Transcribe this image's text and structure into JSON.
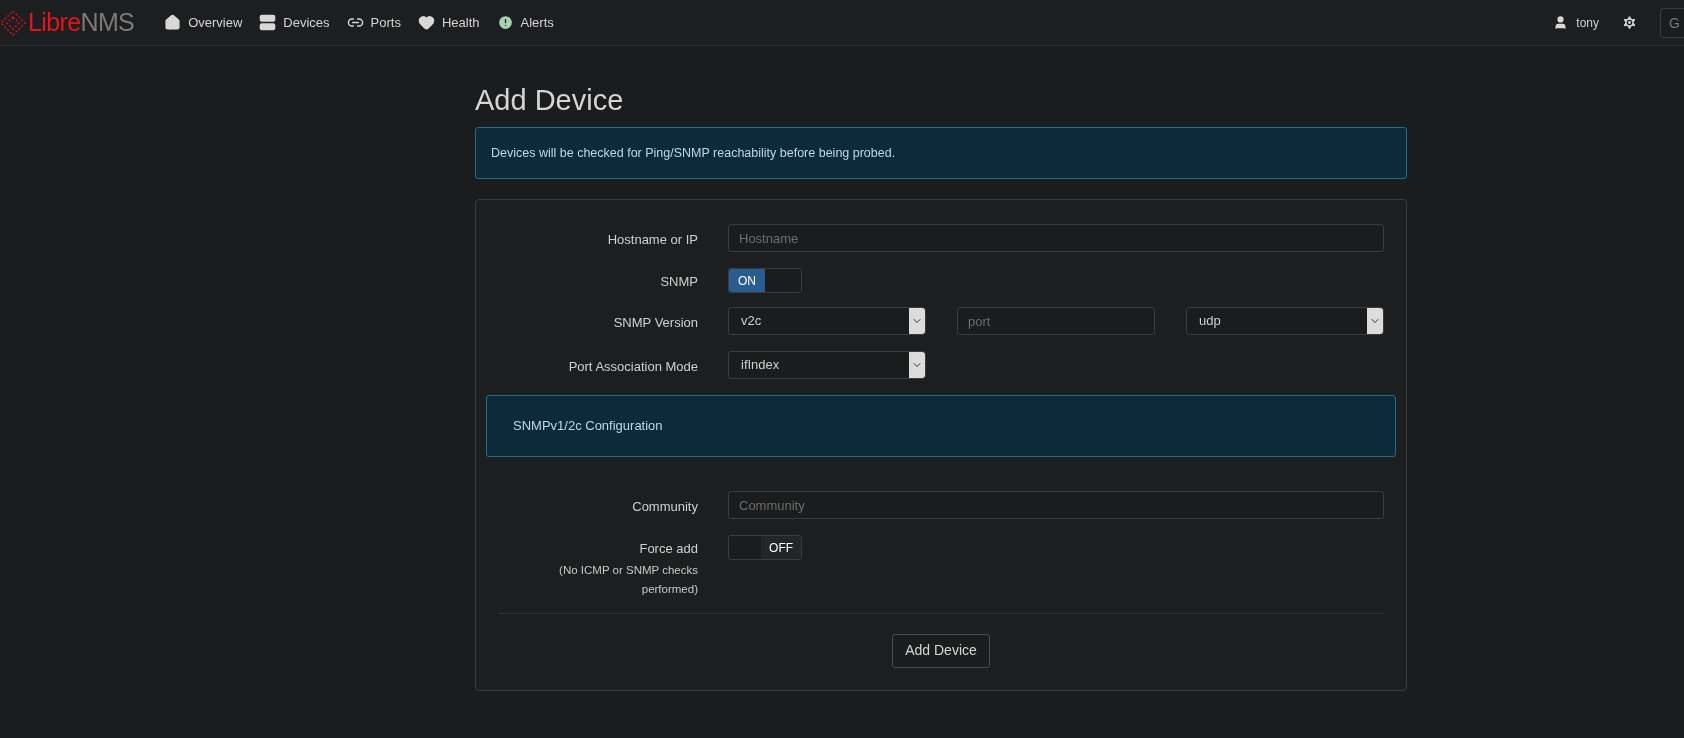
{
  "navbar": {
    "logo": {
      "brand_red": "Libre",
      "brand_grey": "NMS"
    },
    "items": [
      {
        "label": "Overview"
      },
      {
        "label": "Devices"
      },
      {
        "label": "Ports"
      },
      {
        "label": "Health"
      },
      {
        "label": "Alerts"
      }
    ],
    "user": "tony",
    "search": {
      "placeholder": "G"
    }
  },
  "page": {
    "title": "Add Device",
    "notice": "Devices will be checked for Ping/SNMP reachability before being probed.",
    "form": {
      "rows": [
        {
          "kind": "text",
          "label": "Hostname or IP",
          "placeholder": "Hostname"
        },
        {
          "kind": "toggle",
          "label": "SNMP",
          "on": true,
          "text": "ON"
        },
        {
          "kind": "version",
          "label": "SNMP Version",
          "version": "v2c",
          "port_placeholder": "port",
          "transport": "udp"
        },
        {
          "kind": "select",
          "label": "Port Association Mode",
          "value": "ifIndex"
        },
        {
          "kind": "section",
          "title": "SNMPv1/2c Configuration"
        },
        {
          "kind": "text",
          "label": "Community",
          "placeholder": "Community"
        },
        {
          "kind": "toggle",
          "label": "Force add",
          "note": "(No ICMP or SNMP checks performed)",
          "on": false,
          "text": "OFF"
        }
      ],
      "submit": "Add Device"
    }
  }
}
